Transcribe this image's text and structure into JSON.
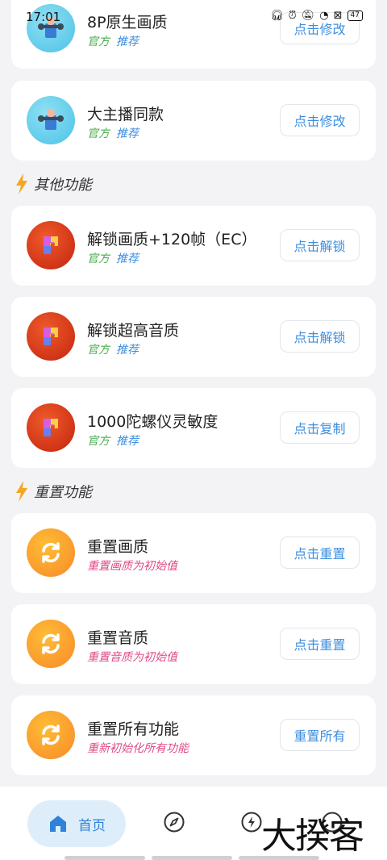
{
  "status_bar": {
    "time": "17:01",
    "battery": "47"
  },
  "cards_top": [
    {
      "title": "8P原生画质",
      "tag1": "官方",
      "tag2": "推荐",
      "button": "点击修改"
    },
    {
      "title": "大主播同款",
      "tag1": "官方",
      "tag2": "推荐",
      "button": "点击修改"
    }
  ],
  "section_other": {
    "title": "其他功能"
  },
  "cards_other": [
    {
      "title": "解锁画质+120帧（EC）",
      "tag1": "官方",
      "tag2": "推荐",
      "button": "点击解锁"
    },
    {
      "title": "解锁超高音质",
      "tag1": "官方",
      "tag2": "推荐",
      "button": "点击解锁"
    },
    {
      "title": "1000陀螺仪灵敏度",
      "tag1": "官方",
      "tag2": "推荐",
      "button": "点击复制"
    }
  ],
  "section_reset": {
    "title": "重置功能"
  },
  "cards_reset": [
    {
      "title": "重置画质",
      "subtitle": "重置画质为初始值",
      "button": "点击重置"
    },
    {
      "title": "重置音质",
      "subtitle": "重置音质为初始值",
      "button": "点击重置"
    },
    {
      "title": "重置所有功能",
      "subtitle": "重新初始化所有功能",
      "button": "重置所有"
    }
  ],
  "bottom_nav": {
    "home_label": "首页"
  },
  "watermark": "大揆客",
  "colors": {
    "accent_blue": "#3d8ede",
    "tag_green": "#4caf50",
    "tag_pink": "#e04a86",
    "bolt": "#f5a623"
  },
  "icons": [
    "wrench-icon",
    "puzzle-icon",
    "refresh-icon",
    "bolt-icon",
    "home-icon",
    "compass-icon"
  ]
}
